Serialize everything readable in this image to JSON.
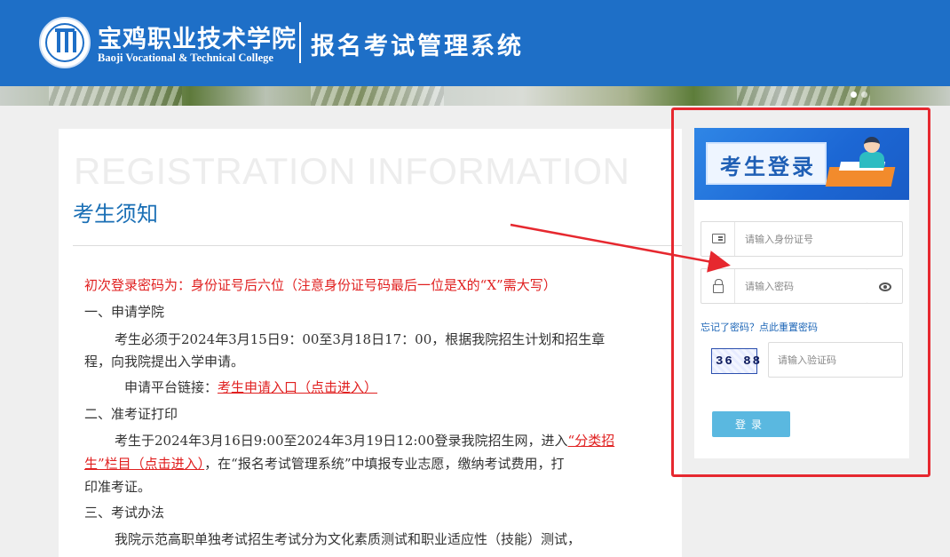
{
  "header": {
    "school_name_cn": "宝鸡职业技术学院",
    "school_name_en": "Baoji Vocational & Technical College",
    "system_title": "报名考试管理系统",
    "bg_color": "#1e6fc7",
    "logo_icon": "college-seal-logo"
  },
  "notice": {
    "watermark": "REGISTRATION INFORMATION",
    "heading": "考生须知",
    "first_login_tip": "初次登录密码为：身份证号后六位（注意身份证号码最后一位是X的“X”需大写）",
    "section1_title": "一、申请学院",
    "section1_p1": "考生必须于2024年3月15日9：00至3月18日17：00，根据我院招生计划和招生章",
    "section1_p2": "程，向我院提出入学申请。",
    "platform_label": "申请平台链接：",
    "platform_link": "考生申请入口（点击进入）",
    "section2_title": "二、准考证打印",
    "section2_p1_a": "考生于2024年3月16日9:00至2024年3月19日12:00登录我院招生网，进入",
    "section2_p1_link": "“分类招",
    "section2_p2_link": "生”栏目（点击进入）",
    "section2_p2_b": "，在“报名考试管理系统”中填报专业志愿，缴纳考试费用，打",
    "section2_p3": "印准考证。",
    "section3_title": "三、考试办法",
    "section3_p1": "我院示范高职单独考试招生考试分为文化素质测试和职业适应性（技能）测试，"
  },
  "login": {
    "banner_title": "考生登录",
    "id_placeholder": "请输入身份证号",
    "password_placeholder": "请输入密码",
    "forgot_text": "忘记了密码？点此重置密码",
    "captcha_text": "36 88",
    "captcha_placeholder": "请输入验证码",
    "submit_label": "登录",
    "button_color": "#5ab8e0",
    "highlight_color": "#e6282f"
  }
}
